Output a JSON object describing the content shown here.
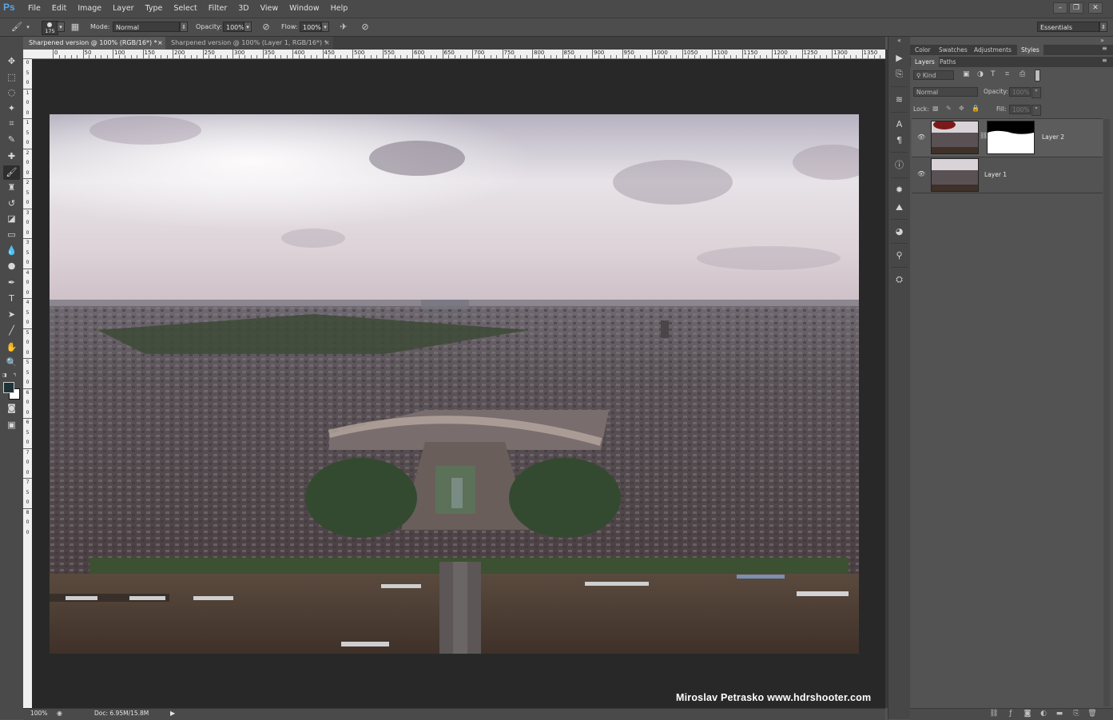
{
  "app": {
    "logo": "Ps",
    "menu": [
      "File",
      "Edit",
      "Image",
      "Layer",
      "Type",
      "Select",
      "Filter",
      "3D",
      "View",
      "Window",
      "Help"
    ],
    "window_controls": [
      "–",
      "❐",
      "✕"
    ]
  },
  "options": {
    "brush_size": "175",
    "mode_label": "Mode:",
    "mode_value": "Normal",
    "opacity_label": "Opacity:",
    "opacity_value": "100%",
    "flow_label": "Flow:",
    "flow_value": "100%",
    "workspace": "Essentials"
  },
  "tabs": [
    {
      "label": "Sharpened version @ 100% (RGB/16*) *",
      "close": "×",
      "active": true
    },
    {
      "label": "Sharpened version @ 100% (Layer 1, RGB/16*) *",
      "close": "×",
      "active": false
    }
  ],
  "ruler": {
    "h_labels": [
      "0",
      "50",
      "100",
      "150",
      "200",
      "250",
      "300",
      "350",
      "400",
      "450",
      "500",
      "550",
      "600",
      "650",
      "700",
      "750",
      "800",
      "850",
      "900",
      "950",
      "1000",
      "1050",
      "1100",
      "1150",
      "1200",
      "1250",
      "1300",
      "1350"
    ],
    "v_labels": [
      "0",
      "5",
      "0",
      "1",
      "0",
      "0",
      "1",
      "5",
      "0",
      "2",
      "0",
      "0",
      "2",
      "5",
      "0",
      "3",
      "0",
      "0",
      "3",
      "5",
      "0",
      "4",
      "0",
      "0",
      "4",
      "5",
      "0",
      "5",
      "0",
      "0",
      "5",
      "5",
      "0",
      "6",
      "0",
      "0",
      "6",
      "5",
      "0",
      "7",
      "0",
      "0",
      "7",
      "5",
      "0",
      "8",
      "0",
      "0"
    ]
  },
  "canvas": {
    "watermark": "Miroslav  Petrasko  www.hdrshooter.com"
  },
  "status": {
    "zoom": "100%",
    "doc": "Doc: 6.95M/15.8M",
    "arrow": "▶"
  },
  "panels": {
    "top_tabs": [
      "Color",
      "Swatches",
      "Adjustments",
      "Styles"
    ],
    "layer_tabs": [
      "Layers",
      "Paths"
    ],
    "kind_filter": "Kind",
    "blend_mode": "Normal",
    "opacity_label": "Opacity:",
    "opacity_value": "100%",
    "lock_label": "Lock:",
    "fill_label": "Fill:",
    "fill_value": "100%",
    "layers": [
      {
        "name": "Layer 2"
      },
      {
        "name": "Layer 1"
      }
    ]
  },
  "icons": {
    "tools": [
      "move-icon",
      "marquee-icon",
      "lasso-icon",
      "magic-wand-icon",
      "crop-icon",
      "eyedropper-icon",
      "healing-icon",
      "brush-icon",
      "clone-stamp-icon",
      "history-brush-icon",
      "eraser-icon",
      "gradient-icon",
      "blur-icon",
      "dodge-icon",
      "pen-icon",
      "type-icon",
      "path-select-icon",
      "line-icon",
      "hand-icon",
      "zoom-icon"
    ],
    "accent": "#5aa6e8"
  }
}
